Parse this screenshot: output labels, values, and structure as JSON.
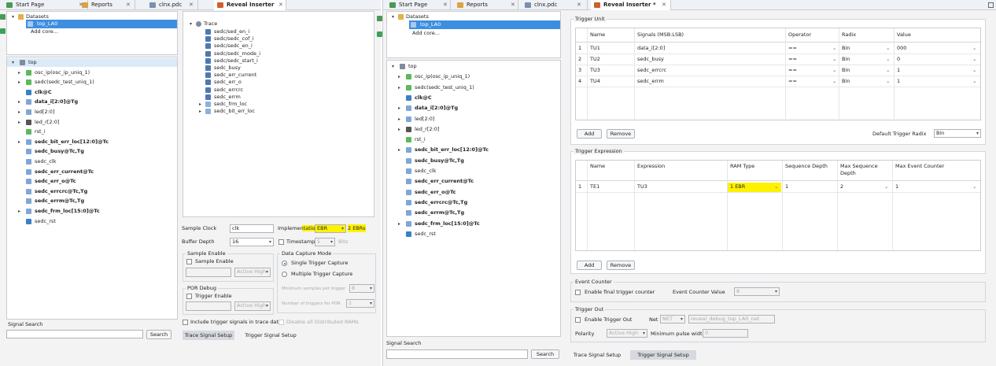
{
  "left": {
    "tabs": [
      {
        "label": "Start Page"
      },
      {
        "label": "Reports"
      },
      {
        "label": "clnx.pdc"
      },
      {
        "label": "Reveal Inserter"
      }
    ],
    "datasets_label": "Datasets",
    "dataset_item": "top_LA0",
    "add_core": "Add core...",
    "tree": [
      {
        "label": "top",
        "bold": false
      },
      {
        "label": "osc_ip(osc_ip_uniq_1)",
        "bold": false
      },
      {
        "label": "sedc(sedc_test_uniq_1)",
        "bold": false
      },
      {
        "label": "clk@C",
        "bold": true
      },
      {
        "label": "data_i[2:0]@Tg",
        "bold": true
      },
      {
        "label": "led[2:0]",
        "bold": false
      },
      {
        "label": "led_r[2:0]",
        "bold": false
      },
      {
        "label": "rst_i",
        "bold": false
      },
      {
        "label": "sedc_bit_err_loc[12:0]@Tc",
        "bold": true
      },
      {
        "label": "sedc_busy@Tc,Tg",
        "bold": true
      },
      {
        "label": "sedc_clk",
        "bold": false
      },
      {
        "label": "sedc_err_current@Tc",
        "bold": true
      },
      {
        "label": "sedc_err_o@Tc",
        "bold": true
      },
      {
        "label": "sedc_errcrc@Tc,Tg",
        "bold": true
      },
      {
        "label": "sedc_errm@Tc,Tg",
        "bold": true
      },
      {
        "label": "sedc_frm_loc[15:0]@Tc",
        "bold": true
      },
      {
        "label": "sedc_rst",
        "bold": false
      }
    ],
    "trace_label": "Trace",
    "trace_items": [
      "sedc/sed_en_i",
      "sedc/sedc_cof_i",
      "sedc/sedc_en_i",
      "sedc/sedc_mode_i",
      "sedc/sedc_start_i",
      "sedc_busy",
      "sedc_err_current",
      "sedc_err_o",
      "sedc_errcrc",
      "sedc_errm",
      "sedc_frm_loc",
      "sedc_bit_err_loc"
    ],
    "signal_search": "Signal Search",
    "search_btn": "Search",
    "sample_clock_label": "Sample Clock",
    "sample_clock_value": "clk",
    "implementation_label": "Implementation",
    "implementation_value": "EBR",
    "ebr_count": "2 EBRs",
    "buffer_depth_label": "Buffer Depth",
    "buffer_depth_value": "16",
    "timestamp_label": "Timestamp",
    "timestamp_value": "5",
    "bits_label": "Bits",
    "sample_enable_group": "Sample Enable",
    "sample_enable_chk": "Sample Enable",
    "active_high": "Active High",
    "data_capture_group": "Data Capture Mode",
    "single_trigger": "Single Trigger Capture",
    "multiple_trigger": "Multiple Trigger Capture",
    "min_samples": "Minimum samples per trigger",
    "min_samples_value": "8",
    "num_triggers": "Number of triggers for POR",
    "num_triggers_value": "1",
    "por_group": "POR Debug",
    "trigger_enable": "Trigger Enable",
    "include_trigger": "Include trigger signals in trace data",
    "disable_rams": "Disable all Distributed RAMs",
    "bottom_tabs": [
      "Trace Signal Setup",
      "Trigger Signal Setup"
    ]
  },
  "right": {
    "tabs": [
      {
        "label": "Start Page"
      },
      {
        "label": "Reports"
      },
      {
        "label": "clnx.pdc"
      },
      {
        "label": "Reveal Inserter *"
      }
    ],
    "datasets_label": "Datasets",
    "dataset_item": "top_LA0",
    "add_core": "Add core...",
    "tree": [
      {
        "label": "top",
        "bold": false
      },
      {
        "label": "osc_ip(osc_ip_uniq_1)",
        "bold": false
      },
      {
        "label": "sedc(sedc_test_uniq_1)",
        "bold": false
      },
      {
        "label": "clk@C",
        "bold": true
      },
      {
        "label": "data_i[2:0]@Tg",
        "bold": true
      },
      {
        "label": "led[2:0]",
        "bold": false
      },
      {
        "label": "led_r[2:0]",
        "bold": false
      },
      {
        "label": "rst_i",
        "bold": false
      },
      {
        "label": "sedc_bit_err_loc[12:0]@Tc",
        "bold": true
      },
      {
        "label": "sedc_busy@Tc,Tg",
        "bold": true
      },
      {
        "label": "sedc_clk",
        "bold": false
      },
      {
        "label": "sedc_err_current@Tc",
        "bold": true
      },
      {
        "label": "sedc_err_o@Tc",
        "bold": true
      },
      {
        "label": "sedc_errcrc@Tc,Tg",
        "bold": true
      },
      {
        "label": "sedc_errm@Tc,Tg",
        "bold": true
      },
      {
        "label": "sedc_frm_loc[15:0]@Tc",
        "bold": true
      },
      {
        "label": "sedc_rst",
        "bold": false
      }
    ],
    "signal_search": "Signal Search",
    "search_btn": "Search",
    "trigger_unit": "Trigger Unit",
    "tu_headers": [
      "Name",
      "Signals (MSB:LSB)",
      "Operator",
      "Radix",
      "Value"
    ],
    "tu_rows": [
      {
        "n": "1",
        "name": "TU1",
        "sig": "data_i[2:0]",
        "op": "==",
        "radix": "Bin",
        "val": "000"
      },
      {
        "n": "2",
        "name": "TU2",
        "sig": "sedc_busy",
        "op": "==",
        "radix": "Bin",
        "val": "0"
      },
      {
        "n": "3",
        "name": "TU3",
        "sig": "sedc_errcrc",
        "op": "==",
        "radix": "Bin",
        "val": "1"
      },
      {
        "n": "4",
        "name": "TU4",
        "sig": "sedc_errm",
        "op": "==",
        "radix": "Bin",
        "val": "1"
      }
    ],
    "add": "Add",
    "remove": "Remove",
    "default_radix_label": "Default Trigger Radix",
    "default_radix_value": "Bin",
    "trigger_expression": "Trigger Expression",
    "te_headers": [
      "Name",
      "Expression",
      "RAM Type",
      "Sequence Depth",
      "Max Sequence Depth",
      "Max Event Counter"
    ],
    "te_rows": [
      {
        "n": "1",
        "name": "TE1",
        "expr": "TU3",
        "ram": "1 EBR",
        "seq": "1",
        "maxseq": "2",
        "maxevt": "1"
      }
    ],
    "event_counter": "Event Counter",
    "enable_final": "Enable final trigger counter",
    "event_counter_value_label": "Event Counter Value",
    "event_counter_value": "8",
    "trigger_out": "Trigger Out",
    "enable_trigger_out": "Enable Trigger Out",
    "net_label": "Net",
    "net_value": "NET",
    "net_name": "reveal_debug_top_LA0_net",
    "polarity_label": "Polarity",
    "polarity_value": "Active High",
    "min_pulse_label": "Minimum pulse width",
    "min_pulse_value": "0",
    "bottom_tabs": [
      "Trace Signal Setup",
      "Trigger Signal Setup"
    ]
  },
  "colors": {
    "selection": "#3c8fe0",
    "highlight": "#fff200",
    "accent": "#2a6fc4"
  }
}
